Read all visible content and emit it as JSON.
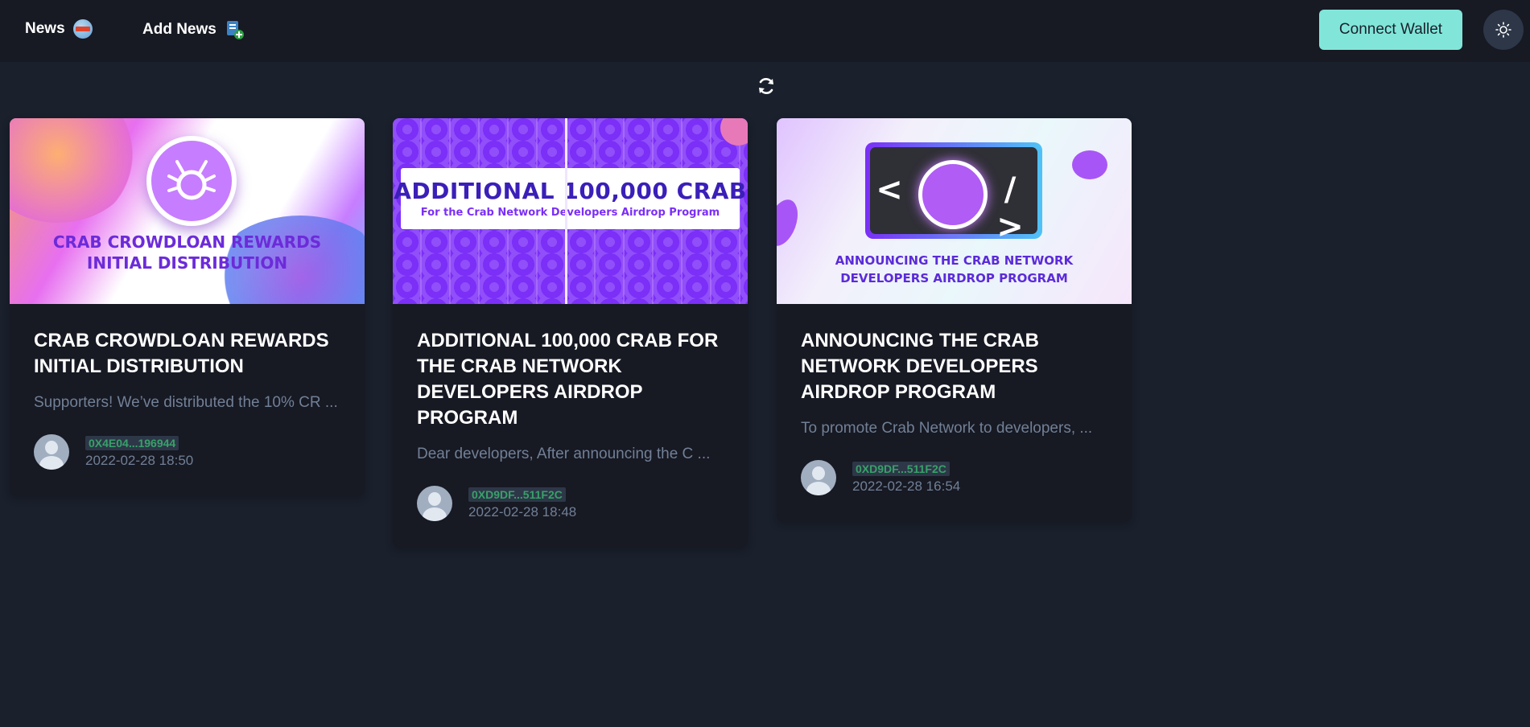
{
  "nav": {
    "news_label": "News",
    "news_icon": "news-badge-icon",
    "add_news_label": "Add News",
    "add_news_icon": "add-document-icon",
    "connect_wallet_label": "Connect Wallet",
    "theme_icon": "sun-icon"
  },
  "toolbar": {
    "refresh_icon": "refresh-icon"
  },
  "colors": {
    "background": "#1a202c",
    "nav_bg": "#171923",
    "accent": "#81e6d9",
    "address_green": "#38a169",
    "muted_text": "#718096"
  },
  "cards": [
    {
      "image": {
        "line1": "CRAB CROWDLOAN REWARDS",
        "line2": "INITIAL DISTRIBUTION"
      },
      "title": "CRAB CROWDLOAN REWARDS INITIAL DISTRIBUTION",
      "excerpt": "Supporters! We’ve distributed the 10% CR ...",
      "address": "0X4E04...196944",
      "date": "2022-02-28 18:50"
    },
    {
      "image": {
        "line1": "ADDITIONAL 100,000 CRAB",
        "line2": "For the Crab Network Developers Airdrop Program"
      },
      "title": "ADDITIONAL 100,000 CRAB FOR THE CRAB NETWORK DEVELOPERS AIRDROP PROGRAM",
      "excerpt": "Dear developers, After announcing the C ...",
      "address": "0XD9DF...511F2C",
      "date": "2022-02-28 18:48"
    },
    {
      "image": {
        "line1": "ANNOUNCING THE CRAB NETWORK",
        "line2": "DEVELOPERS AIRDROP PROGRAM",
        "code_left": "<",
        "code_right": "/ >"
      },
      "title": "ANNOUNCING THE CRAB NETWORK DEVELOPERS AIRDROP PROGRAM",
      "excerpt": "To promote Crab Network to developers, ...",
      "address": "0XD9DF...511F2C",
      "date": "2022-02-28 16:54"
    }
  ]
}
